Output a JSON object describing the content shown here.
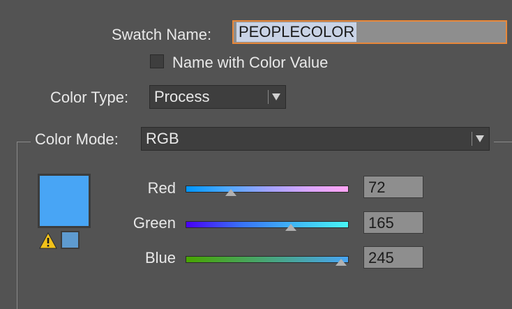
{
  "swatch": {
    "name_label": "Swatch Name:",
    "name_value": "PEOPLECOLOR",
    "name_with_value_label": "Name with Color Value",
    "name_with_value_checked": false,
    "color_type_label": "Color Type:",
    "color_type_value": "Process",
    "color_mode_label": "Color Mode:",
    "color_mode_value": "RGB",
    "preview_color": "#48a5f5"
  },
  "sliders": [
    {
      "label": "Red",
      "value": "72",
      "fraction": 0.282
    },
    {
      "label": "Green",
      "value": "165",
      "fraction": 0.647
    },
    {
      "label": "Blue",
      "value": "245",
      "fraction": 0.961
    }
  ],
  "icons": [
    "warning-icon",
    "dropdown-arrow-icon"
  ]
}
